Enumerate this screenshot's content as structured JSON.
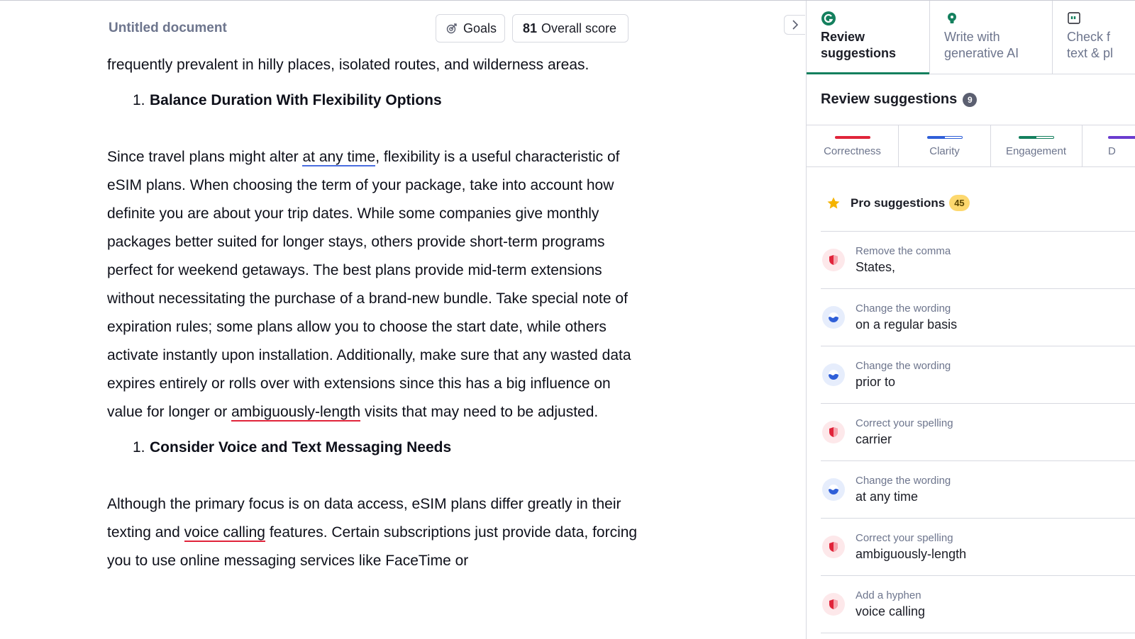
{
  "header": {
    "doc_title": "Untitled document",
    "goals_label": "Goals",
    "score_value": "81",
    "score_label": "Overall score"
  },
  "editor": {
    "line0": "frequently prevalent in hilly places, isolated routes, and wilderness areas.",
    "heading1_num": "1.",
    "heading1": "Balance Duration With Flexibility Options",
    "p1_a": "Since travel plans might alter ",
    "p1_link": "at any time",
    "p1_b": ", flexibility is a useful characteristic of eSIM plans. When choosing the term of your package, take into account how definite you are about your trip dates. While some companies give monthly packages better suited for longer stays, others provide short-term programs perfect for weekend getaways. The best plans provide mid-term extensions without necessitating the purchase of a brand-new bundle. Take special note of expiration rules; some plans allow you to choose the start date, while others activate instantly upon installation. Additionally, make sure that any wasted data expires entirely or rolls over with extensions since this has a big influence on value for longer or ",
    "p1_err": "ambiguously-length",
    "p1_c": " visits that may need to be adjusted.",
    "heading2_num": "1.",
    "heading2": "Consider Voice and Text Messaging Needs",
    "p2_a": "Although the primary focus is on data access, eSIM plans differ greatly in their texting and ",
    "p2_err": "voice calling",
    "p2_b": " features. Certain subscriptions just provide data, forcing you to use online messaging services like FaceTime or"
  },
  "sidebar": {
    "tabs": [
      {
        "label": "Review\nsuggestions",
        "icon": "grammarly-g-icon"
      },
      {
        "label": "Write with\ngenerative AI",
        "icon": "bulb-icon"
      },
      {
        "label": "Check f\ntext & pl",
        "icon": "quote-icon"
      }
    ],
    "title": "Review suggestions",
    "title_count": "9",
    "categories": [
      {
        "label": "Correctness",
        "color": "#e0243a"
      },
      {
        "label": "Clarity",
        "color": "#2f5fd8"
      },
      {
        "label": "Engagement",
        "color": "#14805e"
      },
      {
        "label": "D",
        "color": "#6a3ccf"
      }
    ],
    "pro_label": "Pro suggestions",
    "pro_count": "45",
    "suggestions": [
      {
        "kind": "Remove the comma",
        "word": "States,",
        "type": "correctness"
      },
      {
        "kind": "Change the wording",
        "word": "on a regular basis",
        "type": "clarity"
      },
      {
        "kind": "Change the wording",
        "word": "prior to",
        "type": "clarity"
      },
      {
        "kind": "Correct your spelling",
        "word": "carrier",
        "type": "correctness"
      },
      {
        "kind": "Change the wording",
        "word": "at any time",
        "type": "clarity"
      },
      {
        "kind": "Correct your spelling",
        "word": "ambiguously-length",
        "type": "correctness"
      },
      {
        "kind": "Add a hyphen",
        "word": "voice calling",
        "type": "correctness"
      }
    ]
  }
}
